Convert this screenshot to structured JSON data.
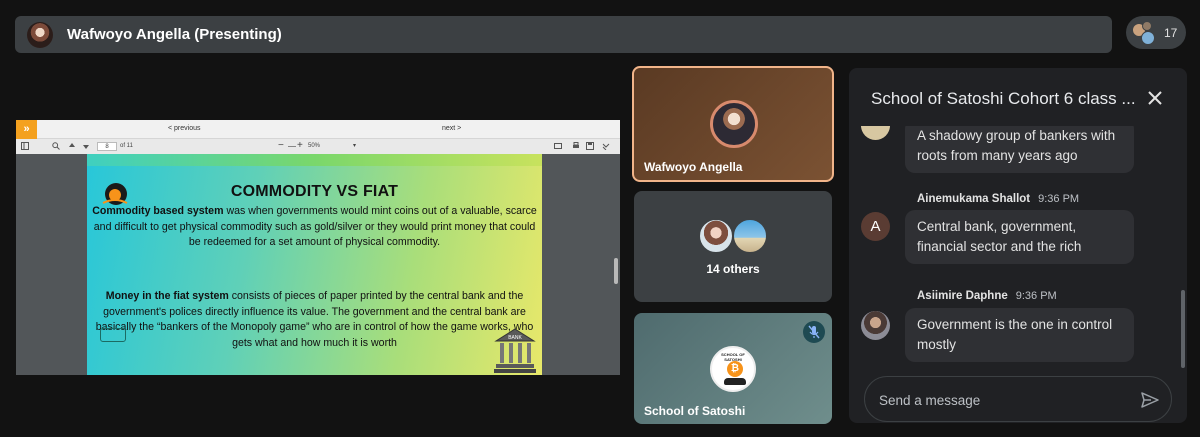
{
  "presenter_bar": {
    "name": "Wafwoyo Angella (Presenting)"
  },
  "people_chip": {
    "count": "17"
  },
  "presentation": {
    "toolbar": {
      "prev_label": "< previous",
      "next_label": "next >",
      "page_current": "8",
      "page_of": "of 11",
      "zoom_minus": "−",
      "zoom_plus": "+",
      "zoom_value": "50%"
    },
    "slide": {
      "title": "COMMODITY VS FIAT",
      "p1_bold": "Commodity based system",
      "p1_text": " was when governments would mint coins out of a valuable, scarce and difficult to get physical commodity such as gold/silver or they would print money that could be redeemed for a set amount of physical commodity.",
      "p2_bold": "Money in the fiat system",
      "p2_text": " consists of pieces of paper printed by the central bank and the government's polices directly influence its value. The government and the central bank are basically the “bankers of the Monopoly game” who are in control of how the game works, who gets what and how much it is worth",
      "bank_label": "BANK"
    }
  },
  "tiles": {
    "presenter": {
      "name": "Wafwoyo Angella"
    },
    "others": {
      "label": "14 others"
    },
    "school": {
      "name": "School of Satoshi",
      "logo_text": "SCHOOL OF SATOSHI"
    }
  },
  "chat": {
    "title": "School of Satoshi Cohort 6 class ...",
    "messages": [
      {
        "sender": "",
        "time": "",
        "text": "A shadowy group of bankers with roots from many years ago"
      },
      {
        "sender": "Ainemukama Shallot",
        "time": "9:36 PM",
        "text": "Central bank, government, financial sector and the rich",
        "avatar_letter": "A"
      },
      {
        "sender": "Asiimire Daphne",
        "time": "9:36 PM",
        "text": "Government is the one in control mostly"
      }
    ],
    "composer_placeholder": "Send a message"
  },
  "colors": {
    "presenter_border": "#f1b489",
    "expand_button": "#f4a11f",
    "tile_bg": "#3c4043",
    "chat_bg": "#202124"
  },
  "icons": {
    "expand": "double-chevron-right-icon",
    "close": "close-icon",
    "send": "send-icon",
    "mic_off": "mic-off-icon"
  }
}
